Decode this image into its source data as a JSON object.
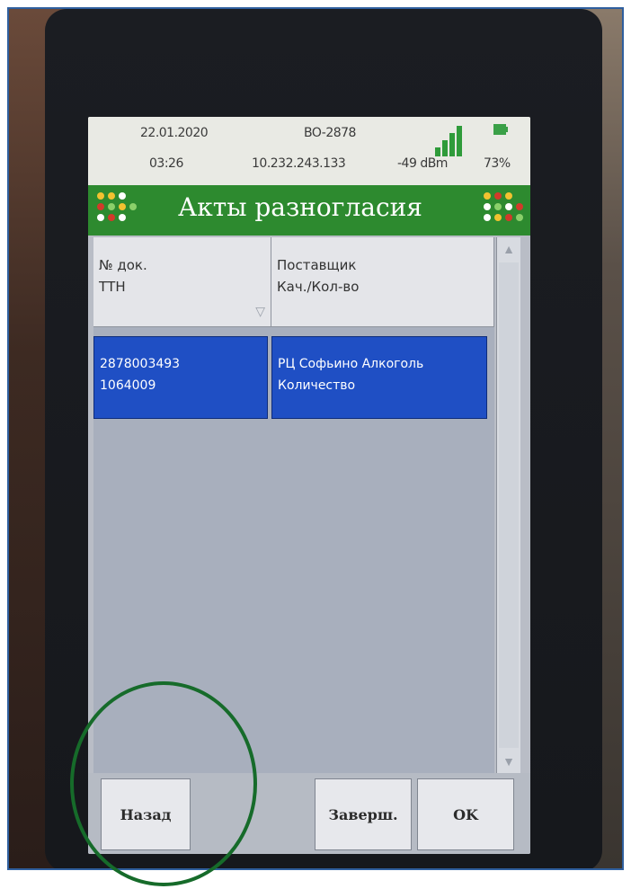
{
  "status": {
    "date": "22.01.2020",
    "time": "03:26",
    "device": "BO-2878",
    "ip": "10.232.243.133",
    "signal": "-49 dBm",
    "battery": "73%"
  },
  "title": "Акты разногласия",
  "table": {
    "columns": [
      {
        "line1": "№ док.",
        "line2": "ТТН"
      },
      {
        "line1": "Поставщик",
        "line2": "Кач./Кол-во"
      }
    ],
    "rows": [
      {
        "doc": "2878003493",
        "ttn": "1064009",
        "supplier": "РЦ Софьино Алкоголь",
        "type": "Количество"
      }
    ]
  },
  "buttons": {
    "back": "Назад",
    "finish": "Заверш.",
    "ok": "OK"
  },
  "colors": {
    "title_green": "#2d8a2f",
    "selection_blue": "#1f4fc4",
    "annotation_green": "#166b2a"
  }
}
